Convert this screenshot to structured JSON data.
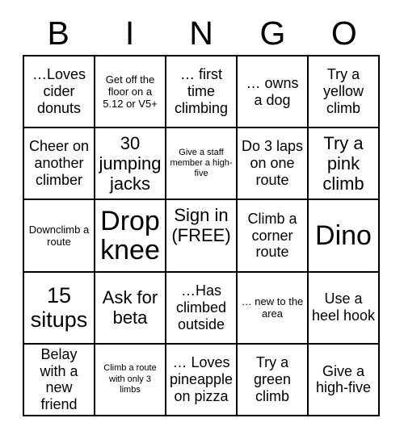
{
  "card": {
    "title": "BINGO",
    "header_letters": [
      "B",
      "I",
      "N",
      "G",
      "O"
    ],
    "rows": 5,
    "columns": 5,
    "colors": {
      "background": "#ffffff",
      "border": "#000000",
      "text": "#000000"
    },
    "cells": [
      [
        {
          "text": "…Loves cider donuts",
          "size": "md"
        },
        {
          "text": "Get off the floor on a 5.12 or V5+",
          "size": "sm"
        },
        {
          "text": "… first time climbing",
          "size": "md"
        },
        {
          "text": "… owns a dog",
          "size": "md"
        },
        {
          "text": "Try a yellow climb",
          "size": "md"
        }
      ],
      [
        {
          "text": "Cheer on another climber",
          "size": "md"
        },
        {
          "text": "30 jumping jacks",
          "size": "lg"
        },
        {
          "text": "Give a staff member a high-five",
          "size": "xs"
        },
        {
          "text": "Do 3 laps on one route",
          "size": "md"
        },
        {
          "text": "Try a pink climb",
          "size": "lg"
        }
      ],
      [
        {
          "text": "Downclimb a route",
          "size": "sm"
        },
        {
          "text": "Drop knee",
          "size": "xxl"
        },
        {
          "text": "Sign in (FREE)",
          "size": "lg",
          "align": "top"
        },
        {
          "text": "Climb a corner route",
          "size": "md"
        },
        {
          "text": "Dino",
          "size": "xxl"
        }
      ],
      [
        {
          "text": "15 situps",
          "size": "xl"
        },
        {
          "text": "Ask for beta",
          "size": "lg"
        },
        {
          "text": "…Has climbed outside",
          "size": "md"
        },
        {
          "text": "… new to the area",
          "size": "sm"
        },
        {
          "text": "Use a heel hook",
          "size": "md"
        }
      ],
      [
        {
          "text": "Belay with a new friend",
          "size": "md"
        },
        {
          "text": "Climb a route with only 3 limbs",
          "size": "xs"
        },
        {
          "text": "… Loves pineapple on pizza",
          "size": "md"
        },
        {
          "text": "Try a green climb",
          "size": "md"
        },
        {
          "text": "Give a high-five",
          "size": "md"
        }
      ]
    ]
  }
}
